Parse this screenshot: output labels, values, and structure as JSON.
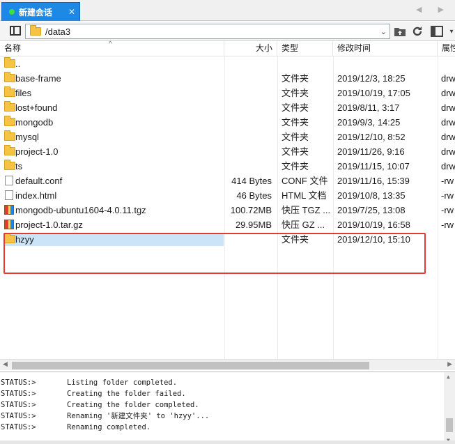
{
  "tab": {
    "label": "新建会话",
    "close": "✕"
  },
  "nav": {
    "arrows": "◀ ▶"
  },
  "address": {
    "path": "/data3"
  },
  "columns": {
    "name": "名称",
    "size": "大小",
    "type": "类型",
    "modified": "修改时间",
    "attributes": "属性"
  },
  "rows": [
    {
      "kind": "folder",
      "name": "..",
      "size": "",
      "type": "",
      "modified": "",
      "attr": ""
    },
    {
      "kind": "folder",
      "name": "base-frame",
      "size": "",
      "type": "文件夹",
      "modified": "2019/12/3, 18:25",
      "attr": "drw"
    },
    {
      "kind": "folder",
      "name": "files",
      "size": "",
      "type": "文件夹",
      "modified": "2019/10/19, 17:05",
      "attr": "drw"
    },
    {
      "kind": "folder",
      "name": "lost+found",
      "size": "",
      "type": "文件夹",
      "modified": "2019/8/11, 3:17",
      "attr": "drw"
    },
    {
      "kind": "folder",
      "name": "mongodb",
      "size": "",
      "type": "文件夹",
      "modified": "2019/9/3, 14:25",
      "attr": "drw"
    },
    {
      "kind": "folder",
      "name": "mysql",
      "size": "",
      "type": "文件夹",
      "modified": "2019/12/10, 8:52",
      "attr": "drw"
    },
    {
      "kind": "folder",
      "name": "project-1.0",
      "size": "",
      "type": "文件夹",
      "modified": "2019/11/26, 9:16",
      "attr": "drw"
    },
    {
      "kind": "folder",
      "name": "ts",
      "size": "",
      "type": "文件夹",
      "modified": "2019/11/15, 10:07",
      "attr": "drw"
    },
    {
      "kind": "doc",
      "name": "default.conf",
      "size": "414 Bytes",
      "type": "CONF 文件",
      "modified": "2019/11/16, 15:39",
      "attr": "-rw"
    },
    {
      "kind": "doc",
      "name": "index.html",
      "size": "46 Bytes",
      "type": "HTML 文档",
      "modified": "2019/10/8, 13:35",
      "attr": "-rw"
    },
    {
      "kind": "archive",
      "name": "mongodb-ubuntu1604-4.0.11.tgz",
      "size": "100.72MB",
      "type": "快压 TGZ ...",
      "modified": "2019/7/25, 13:08",
      "attr": "-rw"
    },
    {
      "kind": "archive",
      "name": "project-1.0.tar.gz",
      "size": "29.95MB",
      "type": "快压 GZ ...",
      "modified": "2019/10/19, 16:58",
      "attr": "-rw"
    },
    {
      "kind": "folder",
      "name": "hzyy",
      "size": "",
      "type": "文件夹",
      "modified": "2019/12/10, 15:10",
      "attr": "",
      "selected": true
    }
  ],
  "log": [
    {
      "status": "STATUS:>",
      "message": "Listing folder completed."
    },
    {
      "status": "STATUS:>",
      "message": "Creating the folder failed."
    },
    {
      "status": "STATUS:>",
      "message": "Creating the folder completed."
    },
    {
      "status": "STATUS:>",
      "message": "Renaming '新建文件夹' to 'hzyy'..."
    },
    {
      "status": "STATUS:>",
      "message": "Renaming completed."
    }
  ],
  "colors": {
    "tab": "#1e88e5",
    "selection": "#cce4f7",
    "highlight_box": "#e53935",
    "folder": "#f6c344"
  }
}
